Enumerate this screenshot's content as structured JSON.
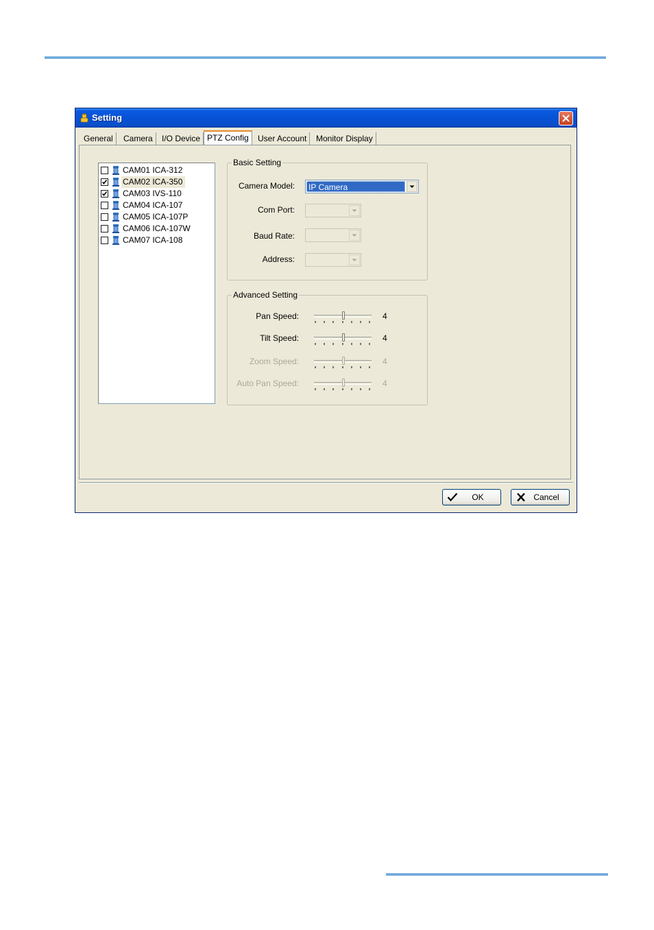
{
  "window": {
    "title": "Setting"
  },
  "tabs": [
    {
      "label": "General"
    },
    {
      "label": "Camera"
    },
    {
      "label": "I/O Device"
    },
    {
      "label": "PTZ Config",
      "active": true
    },
    {
      "label": "User Account"
    },
    {
      "label": "Monitor Display"
    }
  ],
  "cameras": [
    {
      "label": "CAM01 ICA-312",
      "checked": false
    },
    {
      "label": "CAM02 ICA-350",
      "checked": true,
      "selected": true
    },
    {
      "label": "CAM03 IVS-110",
      "checked": true
    },
    {
      "label": "CAM04 ICA-107",
      "checked": false
    },
    {
      "label": "CAM05 ICA-107P",
      "checked": false
    },
    {
      "label": "CAM06 ICA-107W",
      "checked": false
    },
    {
      "label": "CAM07 ICA-108",
      "checked": false
    }
  ],
  "basic": {
    "title": "Basic Setting",
    "camera_model_label": "Camera Model:",
    "camera_model_value": "IP Camera",
    "com_port_label": "Com Port:",
    "baud_rate_label": "Baud Rate:",
    "address_label": "Address:"
  },
  "advanced": {
    "title": "Advanced Setting",
    "pan_label": "Pan Speed:",
    "pan_value": "4",
    "tilt_label": "Tilt Speed:",
    "tilt_value": "4",
    "zoom_label": "Zoom Speed:",
    "zoom_value": "4",
    "autopan_label": "Auto Pan Speed:",
    "autopan_value": "4"
  },
  "buttons": {
    "ok": "OK",
    "cancel": "Cancel"
  },
  "colors": {
    "title_bar": "#0852d6",
    "dialog_bg": "#ece9d8",
    "selection": "#316ac5",
    "close_button": "#c8431f"
  },
  "icons": {
    "title": "ptz-setting-icon",
    "camera": "camera-icon",
    "ok": "checkmark-icon",
    "cancel": "x-icon"
  }
}
